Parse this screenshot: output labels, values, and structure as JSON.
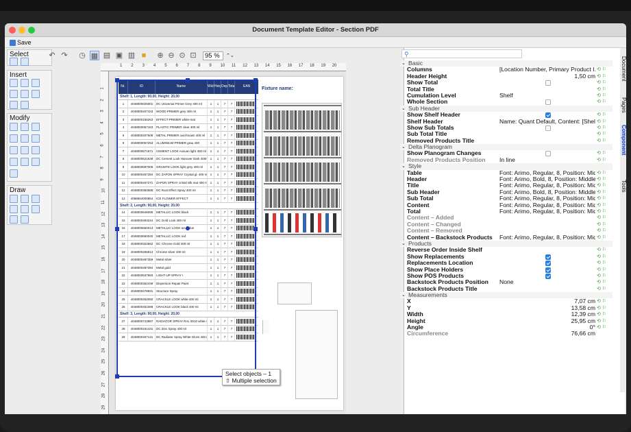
{
  "window": {
    "title": "Document Template Editor - Section PDF"
  },
  "savebar": {
    "save": "Save"
  },
  "sidebar": {
    "select": "Select",
    "insert": "Insert",
    "modify": "Modify",
    "draw": "Draw"
  },
  "toolbar": {
    "zoom": "95 %",
    "zoom_stepper": "⌃⌄"
  },
  "ruler": {
    "h": [
      "1",
      "2",
      "3",
      "4",
      "5",
      "6",
      "7",
      "8",
      "9",
      "10",
      "11",
      "12",
      "13",
      "14",
      "15",
      "16",
      "17",
      "18",
      "19",
      "20"
    ],
    "v": [
      "1",
      "2",
      "3",
      "4",
      "5",
      "6",
      "7",
      "8",
      "9",
      "10",
      "11",
      "12",
      "13",
      "14",
      "15",
      "16",
      "17",
      "18",
      "19",
      "20",
      "21",
      "22",
      "23",
      "24",
      "25",
      "26",
      "27",
      "28",
      "29"
    ]
  },
  "page": {
    "fixture_label": "Fixture name:",
    "headers": [
      "Nr.",
      "ID",
      "Name",
      "Width",
      "Height",
      "Depth",
      "Total",
      "EAN"
    ],
    "shelf1": "Shelf: 1, Length: 90,00, Height: 20,00",
    "shelf2": "Shelf: 2, Length: 90,00, Height: 20,00",
    "shelf3": "Shelf: 3, Length: 90,00, Height: 20,00",
    "rows1": [
      [
        "1",
        "4048000025001",
        "DC Universal Primer Grey 400 ml"
      ],
      [
        "2",
        "4048000407433",
        "WOOD PRIMER grey 400 ml"
      ],
      [
        "3",
        "4048000156263",
        "EFFECT-PRIMER white-mat"
      ],
      [
        "4",
        "4048000057163",
        "PLASTIC PRIMER clear 400 ml"
      ],
      [
        "5",
        "4048000407508",
        "METAL PRIMER oxid-brown 400 ml"
      ],
      [
        "6",
        "4048000057253",
        "ALUMINIUM PRIMER grau 400"
      ],
      [
        "7",
        "4048000571671",
        "CEMENT LOOK Assuan light 400 ml"
      ],
      [
        "8",
        "4048000521638",
        "DC Cement Look Hanover Dark 400ml"
      ],
      [
        "9",
        "4048000697005",
        "GRANITE LOOK light grey 400 ml"
      ],
      [
        "10",
        "4048000467284",
        "DC ZAPON SPRAY Crystal gl. 400 ml"
      ],
      [
        "11",
        "4048000467271",
        "ZAPON SPRAY cristal silk mat 400 ml"
      ],
      [
        "12",
        "4048000383588",
        "DC Rust Effect Spray 400 ml"
      ],
      [
        "13",
        "4068664000864",
        "ICE FLOWER EFFECT"
      ]
    ],
    "rows2": [
      [
        "14",
        "4048000648095",
        "METALLIC LOOK black"
      ],
      [
        "15",
        "4048000493244",
        "DC Gold Look 400 ml"
      ],
      [
        "16",
        "4048000660013",
        "METALLIC LOOK azur blue"
      ],
      [
        "17",
        "4048000660040",
        "METALLIC LOOK red"
      ],
      [
        "18",
        "4048000322662",
        "DC Chrome Gold 400 ml"
      ],
      [
        "19",
        "4048000285813",
        "Chrome silver 400 ml"
      ],
      [
        "20",
        "4048000487359",
        "Metal silver"
      ],
      [
        "21",
        "4048000487394",
        "Metal gold"
      ],
      [
        "22",
        "4048000537860",
        "LIGHT-UP SPRAY I"
      ],
      [
        "23",
        "4048000362439",
        "Dispersion Repair Paint"
      ],
      [
        "24",
        "4048000478831",
        "Structure Spray"
      ],
      [
        "25",
        "4048000452050",
        "CRACKLE LOOK white 400 ml"
      ],
      [
        "26",
        "4048000451089",
        "CRACKLE LOOK black 400 ml"
      ]
    ],
    "rows3": [
      [
        "27",
        "4048000743887",
        "RADIATOR SPRAY RAL 9010 white semi-mat 400 ml"
      ],
      [
        "28",
        "4048000161431",
        "DC Zinc Spray 400 ml"
      ],
      [
        "29",
        "4048000467141",
        "DC Radiator Spray White Gloss 400 ml"
      ]
    ],
    "cell_dims": [
      "1",
      "1",
      "7",
      "7"
    ]
  },
  "tooltip": {
    "line1": "Select objects – 1",
    "line2": "⇧ Multiple selection"
  },
  "tabs": [
    "Document",
    "Pages",
    "Component",
    "Tools"
  ],
  "props": [
    {
      "g": "Basic"
    },
    {
      "n": "Columns",
      "v": "[Location Number, Primary Product I...",
      "a": "1"
    },
    {
      "n": "Header Height",
      "v": "1,50 cm",
      "r": "1",
      "a": "1"
    },
    {
      "n": "Show Total",
      "cb": "0",
      "a": "1"
    },
    {
      "n": "Total Title",
      "a": "1"
    },
    {
      "n": "Cumulation Level",
      "v": "Shelf",
      "a": "1"
    },
    {
      "n": "Whole Section",
      "cb": "0",
      "a": "1"
    },
    {
      "g": "Sub Header"
    },
    {
      "n": "Show Shelf Header",
      "cb": "1",
      "a": "1"
    },
    {
      "n": "Shelf Header",
      "v": "Name: Quant Default, Content: [Shelf ...",
      "a": "1"
    },
    {
      "n": "Show Sub Totals",
      "cb": "0",
      "a": "1"
    },
    {
      "n": "Sub Total Title",
      "a": "1"
    },
    {
      "n": "Removed Products Title",
      "a": "1"
    },
    {
      "g": "Delta Planogram"
    },
    {
      "n": "Show Planogram Changes",
      "cb": "0",
      "a": "1"
    },
    {
      "n": "Removed Products Position",
      "v": "In line",
      "d": "1",
      "a": "1"
    },
    {
      "g": "Style"
    },
    {
      "n": "Table",
      "v": "Font: Arimo, Regular, 8, Position: Mid...",
      "a": "1"
    },
    {
      "n": "Header",
      "v": "Font: Arimo, Bold, 8, Position: Middle...",
      "a": "1"
    },
    {
      "n": "Title",
      "v": "Font: Arimo, Regular, 8, Position: Mid...",
      "a": "1"
    },
    {
      "n": "Sub Header",
      "v": "Font: Arimo, Bold, 8, Position: Middle...",
      "a": "1"
    },
    {
      "n": "Sub Total",
      "v": "Font: Arimo, Regular, 8, Position: Mid...",
      "a": "1"
    },
    {
      "n": "Content",
      "v": "Font: Arimo, Regular, 8, Position: Mid...",
      "a": "1"
    },
    {
      "n": "Total",
      "v": "Font: Arimo, Regular, 8, Position: Mid...",
      "a": "1"
    },
    {
      "n": "Content – Added",
      "d": "1",
      "a": "1"
    },
    {
      "n": "Content – Changed",
      "d": "1",
      "a": "1"
    },
    {
      "n": "Content – Removed",
      "d": "1",
      "a": "1"
    },
    {
      "n": "Content – Backstock Products",
      "v": "Font: Arimo, Regular, 8, Position: Mid...",
      "a": "1"
    },
    {
      "g": "Products"
    },
    {
      "n": "Reverse Order Inside Shelf",
      "a": "1"
    },
    {
      "n": "Show Replacements",
      "cb": "1",
      "a": "1"
    },
    {
      "n": "Replacements Location",
      "cb": "1",
      "a": "1"
    },
    {
      "n": "Show Place Holders",
      "cb": "1",
      "a": "1"
    },
    {
      "n": "Show POS Products",
      "cb": "1",
      "a": "1"
    },
    {
      "n": "Backstock Products Position",
      "v": "None",
      "a": "1"
    },
    {
      "n": "Backstock Products Title",
      "a": "1"
    },
    {
      "g": "Measurements"
    },
    {
      "n": "X",
      "v": "7,07 cm",
      "r": "1",
      "a": "1"
    },
    {
      "n": "Y",
      "v": "13,58 cm",
      "r": "1",
      "a": "1"
    },
    {
      "n": "Width",
      "v": "12,39 cm",
      "r": "1",
      "a": "1"
    },
    {
      "n": "Height",
      "v": "25,95 cm",
      "r": "1",
      "a": "1"
    },
    {
      "n": "Angle",
      "v": "0°",
      "r": "1",
      "a": "1"
    },
    {
      "n": "Circumference",
      "v": "76,66 cm",
      "r": "1",
      "d": "1"
    }
  ]
}
